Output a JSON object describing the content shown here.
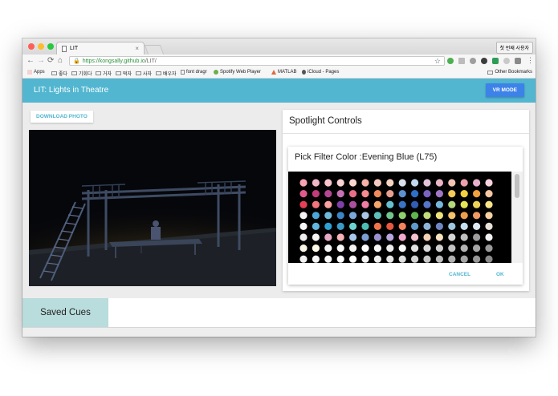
{
  "browser": {
    "tab_title": "LIT",
    "tab_close": "×",
    "user_button": "첫 번째 사용자",
    "nav": {
      "back": "←",
      "forward": "→",
      "reload": "⟳",
      "home": "⌂"
    },
    "url_lock": "🔒",
    "url_host": "https://kongsally.github.io",
    "url_path": "/LIT/",
    "star": "☆",
    "menu": "⋮",
    "bookmarks": [
      "Apps",
      "좋다",
      "기회다",
      "거자",
      "떡자",
      "사자",
      "배우자",
      "font dragr",
      "Spotify Web Player",
      "MATLAB",
      "iCloud - Pages"
    ],
    "other_bookmarks": "Other Bookmarks"
  },
  "app": {
    "title": "LIT: Lights in Theatre",
    "vr_button": "VR MODE",
    "download_button": "DOWNLOAD PHOTO",
    "spotlight_title": "Spotlight Controls",
    "dialog_title": "Pick Filter Color :Evening Blue (L75)",
    "cancel_button": "CANCEL",
    "ok_button": "OK",
    "saved_cues": "Saved Cues"
  },
  "colors": {
    "accent": "#52b6d0",
    "vr_button": "#3d82e8",
    "saved_tab": "#b9dcdc",
    "swatch_rows": [
      [
        "#f7a4b2",
        "#f3b6c8",
        "#f7c3cc",
        "#f9d3d6",
        "#fbd6cf",
        "#f6b1a9",
        "#f7c8bf",
        "#f4d5c2",
        "#d9e0ec",
        "#c2d8ef",
        "#e0c2d9",
        "#ebb5c6",
        "#f4c4b6",
        "#ee9fae",
        "#e7b1cd",
        "#f9d2e0"
      ],
      [
        "#e05b8a",
        "#c23b7b",
        "#b44794",
        "#c771b4",
        "#eb6e88",
        "#f58a8f",
        "#f28a5b",
        "#e7a08f",
        "#5d90cf",
        "#2e6fc7",
        "#7a63c0",
        "#a076c6",
        "#f7cb58",
        "#f3d23e",
        "#f4a03f",
        "#f6c7a2"
      ],
      [
        "#e83f56",
        "#f3747a",
        "#f8a1a0",
        "#7f3fa6",
        "#a9509f",
        "#ef7da4",
        "#f5a76b",
        "#66c1cf",
        "#3a72c4",
        "#315db3",
        "#5575c7",
        "#76b7de",
        "#b4d87c",
        "#e2e657",
        "#ecd256",
        "#f9e48a"
      ],
      [
        "#f4f4f4",
        "#4aa8d9",
        "#6fb9dc",
        "#3b84c5",
        "#7ba6dc",
        "#a9c6e4",
        "#5ec0b6",
        "#72c48f",
        "#8fd16d",
        "#5fb64e",
        "#c3dc78",
        "#f0e27a",
        "#f5c46b",
        "#ef9f4b",
        "#f29a63",
        "#f7d2a3"
      ],
      [
        "#f6f6f6",
        "#62b5dd",
        "#2fa0d4",
        "#3a9bc6",
        "#6cd3d0",
        "#4bbdb2",
        "#f2744b",
        "#e8573f",
        "#f5825c",
        "#5e9acb",
        "#8fb4d9",
        "#6e87c4",
        "#9ec7e2",
        "#c6dff0",
        "#dde9f3",
        "#e8e2d8"
      ],
      [
        "#ededed",
        "#f4f4f4",
        "#e7a8c6",
        "#f6b3b8",
        "#a7c7ea",
        "#7a9ed3",
        "#9b91d1",
        "#b9a6dd",
        "#f2a9cc",
        "#f5c1cf",
        "#f6d0b4",
        "#f9e2c1",
        "#d6d6d6",
        "#bfbfbf",
        "#9d9d9d",
        "#f2f2f2"
      ],
      [
        "#f8f4e8",
        "#fdf9e9",
        "#f5f5f5",
        "#fafafa",
        "#f3f3f3",
        "#ffffff",
        "#f7f7f7",
        "#ececec",
        "#f9f9f9",
        "#e2e2e2",
        "#d8d8d8",
        "#cfcfcf",
        "#c2c2c2",
        "#b3b3b3",
        "#a6a6a6",
        "#9a9a9a"
      ],
      [
        "#f2f2f2",
        "#f6f6f6",
        "#f9f9f9",
        "#fcfcfc",
        "#ffffff",
        "#f4f4f4",
        "#eeeeee",
        "#e7e7e7",
        "#dedede",
        "#d4d4d4",
        "#c9c9c9",
        "#bdbdbd",
        "#b0b0b0",
        "#a3a3a3",
        "#979797",
        "#8b8b8b"
      ]
    ]
  }
}
